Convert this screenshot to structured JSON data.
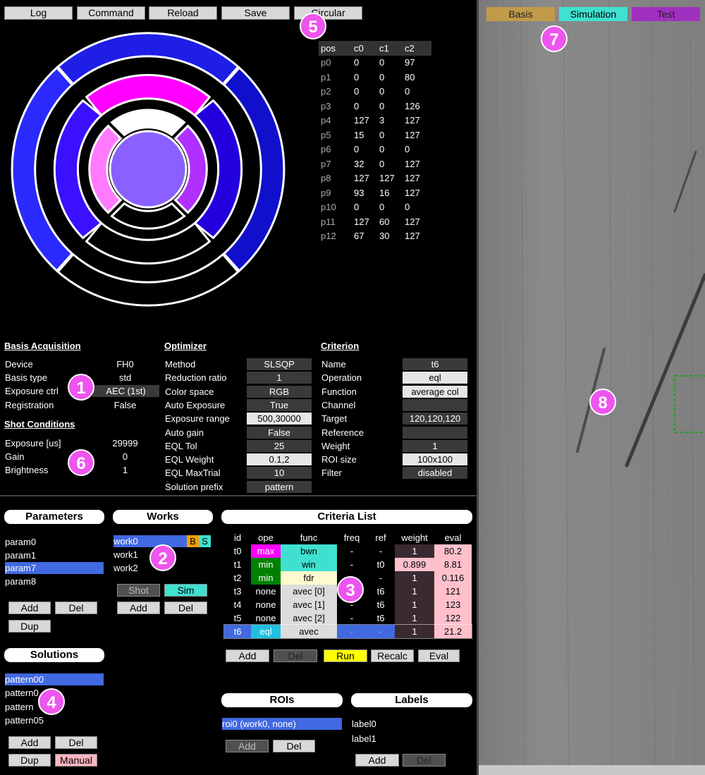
{
  "toolbar": {
    "log": "Log",
    "command": "Command",
    "reload": "Reload",
    "save": "Save",
    "circular": "Circular"
  },
  "right_tabs": {
    "basis": "Basis",
    "simulation": "Simulation",
    "test": "Test"
  },
  "badges": [
    "1",
    "2",
    "3",
    "4",
    "5",
    "6",
    "7",
    "8"
  ],
  "pos_table": {
    "headers": [
      "pos",
      "c0",
      "c1",
      "c2"
    ],
    "rows": [
      [
        "p0",
        "0",
        "0",
        "97"
      ],
      [
        "p1",
        "0",
        "0",
        "80"
      ],
      [
        "p2",
        "0",
        "0",
        "0"
      ],
      [
        "p3",
        "0",
        "0",
        "126"
      ],
      [
        "p4",
        "127",
        "3",
        "127"
      ],
      [
        "p5",
        "15",
        "0",
        "127"
      ],
      [
        "p6",
        "0",
        "0",
        "0"
      ],
      [
        "p7",
        "32",
        "0",
        "127"
      ],
      [
        "p8",
        "127",
        "127",
        "127"
      ],
      [
        "p9",
        "93",
        "16",
        "127"
      ],
      [
        "p10",
        "0",
        "0",
        "0"
      ],
      [
        "p11",
        "127",
        "60",
        "127"
      ],
      [
        "p12",
        "67",
        "30",
        "127"
      ]
    ]
  },
  "basis": {
    "title": "Basis Acquisition",
    "device_l": "Device",
    "device_v": "FH0",
    "type_l": "Basis type",
    "type_v": "std",
    "exp_l": "Exposure ctrl",
    "exp_v": "AEC (1st)",
    "reg_l": "Registration",
    "reg_v": "False"
  },
  "shot": {
    "title": "Shot Conditions",
    "exp_l": "Exposure [us]",
    "exp_v": "29999",
    "gain_l": "Gain",
    "gain_v": "0",
    "bri_l": "Brightness",
    "bri_v": "1"
  },
  "optimizer": {
    "title": "Optimizer",
    "rows": [
      [
        "Method",
        "SLSQP"
      ],
      [
        "Reduction ratio",
        "1"
      ],
      [
        "Color space",
        "RGB"
      ],
      [
        "Auto Exposure",
        "True"
      ],
      [
        "Exposure range",
        "500,30000"
      ],
      [
        "Auto gain",
        "False"
      ],
      [
        "EQL Tol",
        "25"
      ],
      [
        "EQL Weight",
        "0.1,2"
      ],
      [
        "EQL MaxTrial",
        "10"
      ],
      [
        "Solution prefix",
        "pattern"
      ]
    ]
  },
  "criterion": {
    "title": "Criterion",
    "rows": [
      [
        "Name",
        "t6"
      ],
      [
        "Operation",
        "eql"
      ],
      [
        "Function",
        "average col"
      ],
      [
        "Channel",
        ""
      ],
      [
        "Target",
        "120,120,120"
      ],
      [
        "Reference",
        ""
      ],
      [
        "Weight",
        "1"
      ],
      [
        "ROI size",
        "100x100"
      ],
      [
        "Filter",
        "disabled"
      ]
    ]
  },
  "parameters": {
    "title": "Parameters",
    "items": [
      "param0",
      "param1",
      "param7",
      "param8"
    ],
    "add": "Add",
    "del": "Del",
    "dup": "Dup"
  },
  "works": {
    "title": "Works",
    "items": [
      "work0",
      "work1",
      "work2"
    ],
    "b": "B",
    "s": "S",
    "shot": "Shot",
    "sim": "Sim",
    "add": "Add",
    "del": "Del"
  },
  "criteria": {
    "title": "Criteria List",
    "headers": [
      "id",
      "ope",
      "func",
      "freq",
      "ref",
      "weight",
      "eval"
    ],
    "rows": [
      [
        "t0",
        "max",
        "bwn",
        "-",
        "-",
        "1",
        "80.2"
      ],
      [
        "t1",
        "min",
        "win",
        "-",
        "t0",
        "0.899",
        "8.81"
      ],
      [
        "t2",
        "min",
        "fdr",
        "-",
        "-",
        "1",
        "0.116"
      ],
      [
        "t3",
        "none",
        "avec [0]",
        "-",
        "t6",
        "1",
        "121"
      ],
      [
        "t4",
        "none",
        "avec [1]",
        "-",
        "t6",
        "1",
        "123"
      ],
      [
        "t5",
        "none",
        "avec [2]",
        "-",
        "t6",
        "1",
        "122"
      ],
      [
        "t6",
        "eql",
        "avec",
        "-",
        "-",
        "1",
        "21.2"
      ]
    ],
    "add": "Add",
    "del": "Del",
    "run": "Run",
    "recalc": "Recalc",
    "eval": "Eval"
  },
  "solutions": {
    "title": "Solutions",
    "items": [
      "pattern00",
      "pattern0",
      "pattern",
      "pattern05"
    ],
    "add": "Add",
    "del": "Del",
    "dup": "Dup",
    "manual": "Manual"
  },
  "rois": {
    "title": "ROIs",
    "items": [
      "roi0 (work0, none)"
    ],
    "add": "Add",
    "del": "Del"
  },
  "labels": {
    "title": "Labels",
    "items": [
      "label0",
      "label1"
    ],
    "add": "Add",
    "del": "Del"
  },
  "colors": {
    "accent": "#4169e1",
    "ring_outer": "#1e1ee6",
    "magenta": "#ff00ff",
    "pink": "#ff7aff",
    "violet": "#b030ff",
    "center": "#8a60ff"
  }
}
